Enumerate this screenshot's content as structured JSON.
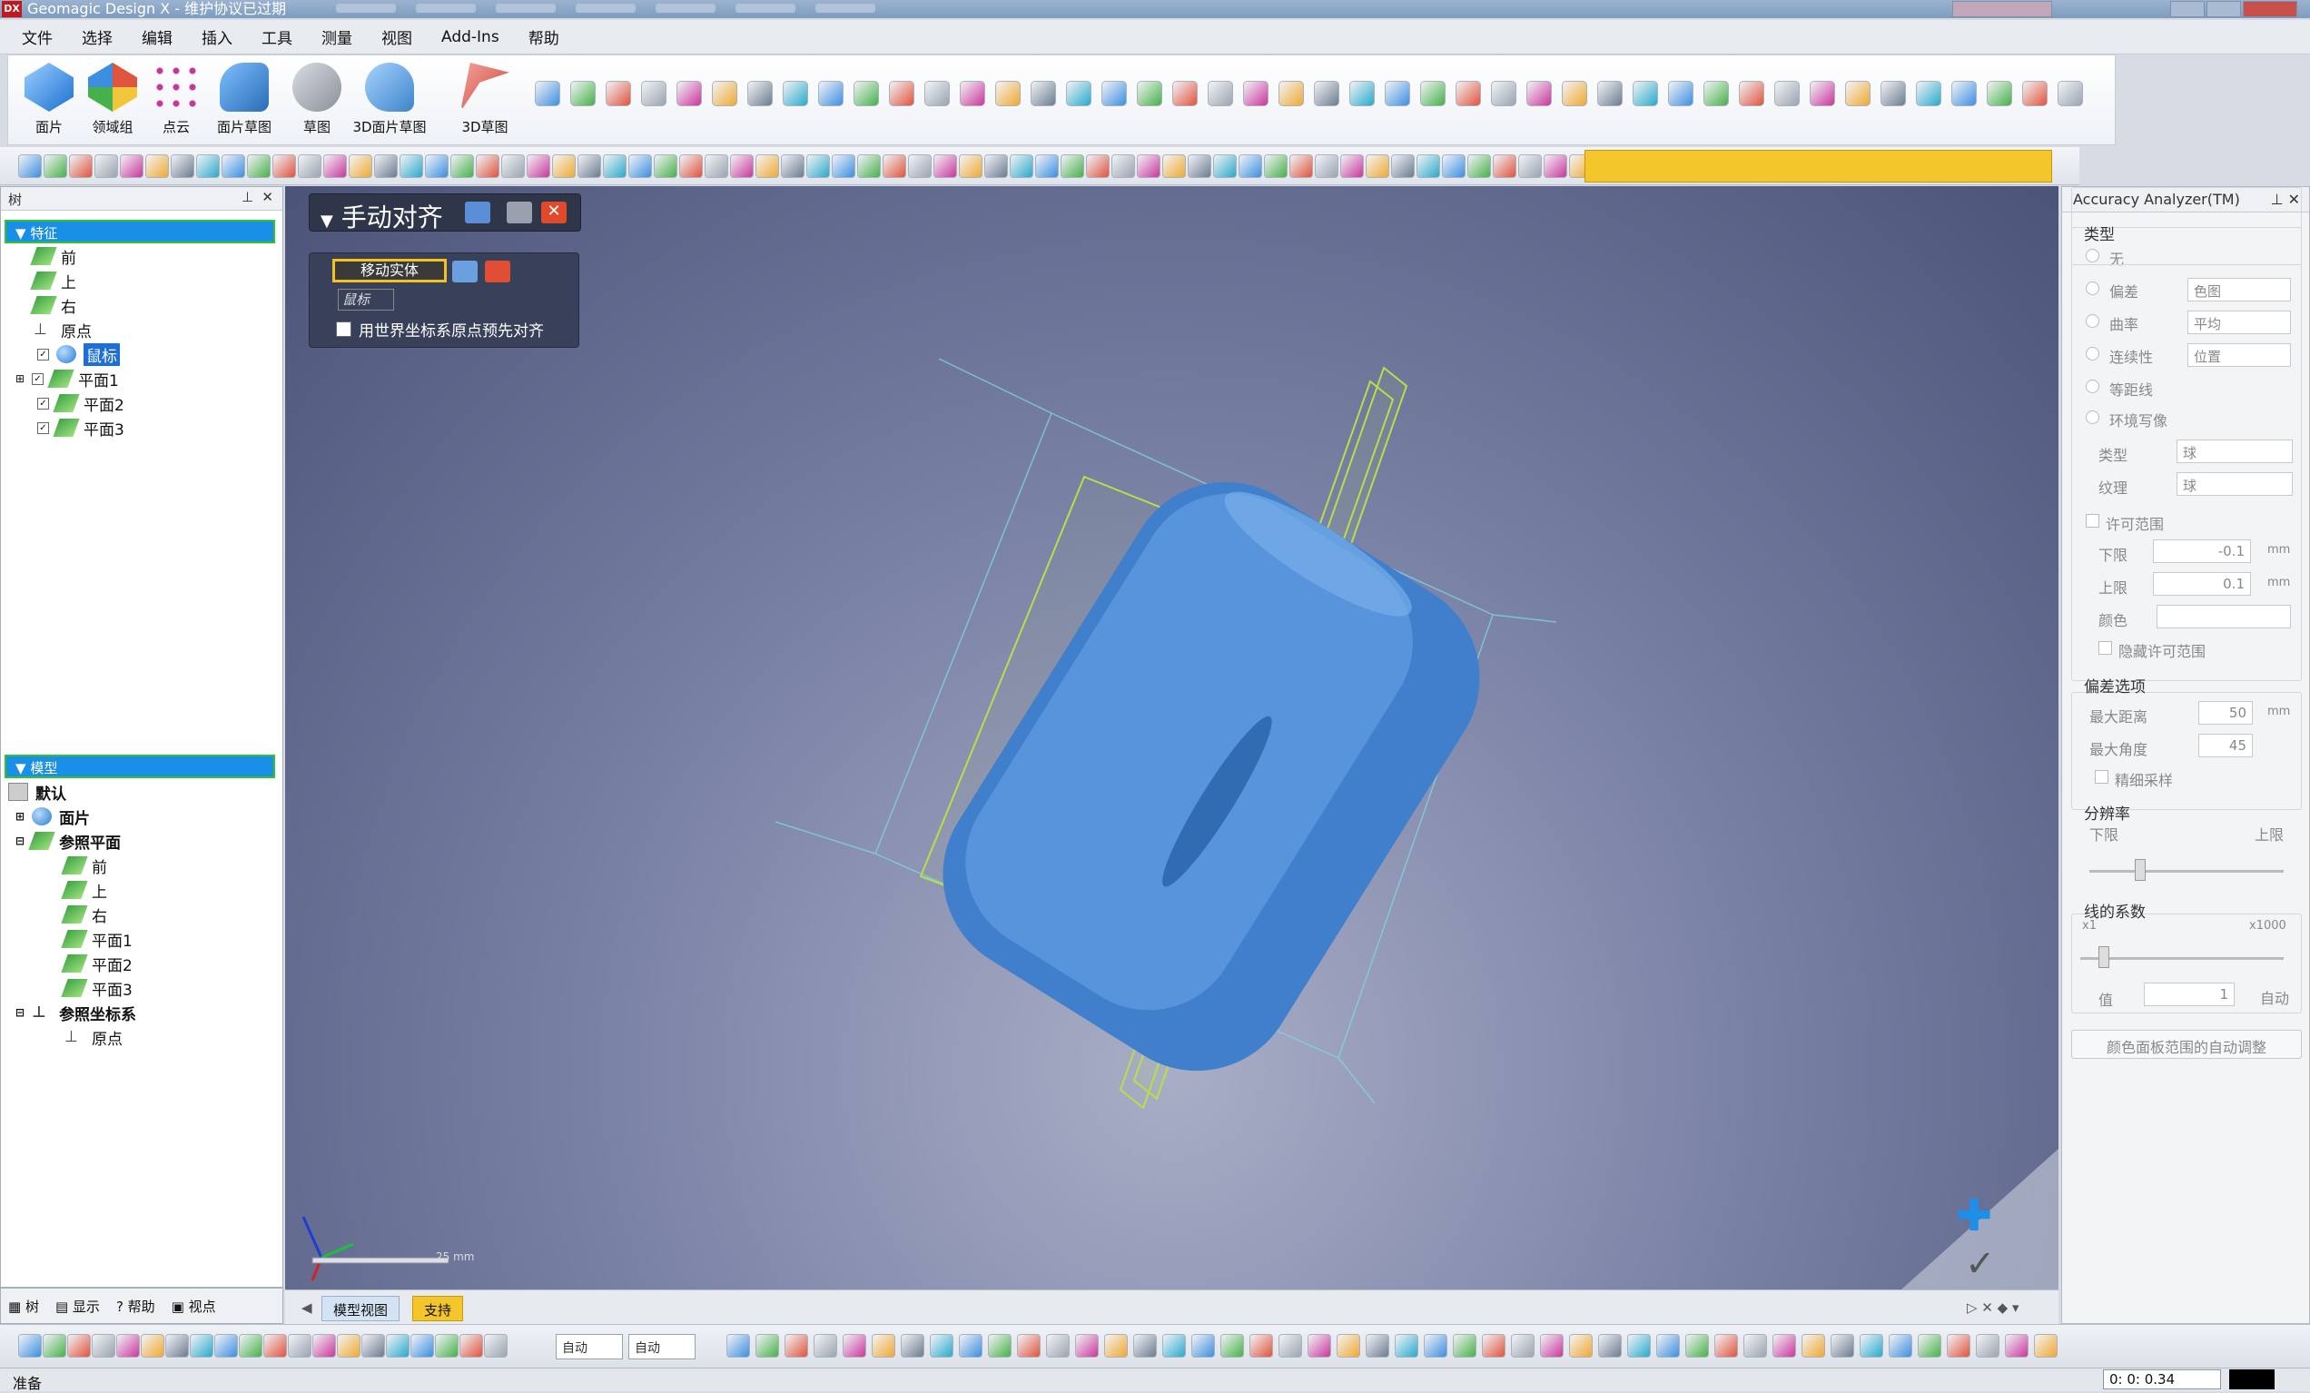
{
  "window": {
    "title": "Geomagic Design X - 维护协议已过期",
    "logo": "DX"
  },
  "menu": [
    "文件",
    "选择",
    "编辑",
    "插入",
    "工具",
    "测量",
    "视图",
    "Add-Ins",
    "帮助"
  ],
  "ribbon": {
    "big_tools": [
      {
        "label": "面片",
        "icon": "mesh-icon",
        "color": "#3b8ee0"
      },
      {
        "label": "领域组",
        "icon": "region-group-icon",
        "color": "#e0533c"
      },
      {
        "label": "点云",
        "icon": "point-cloud-icon",
        "color": "#c9369b"
      },
      {
        "label": "面片草图",
        "icon": "mesh-sketch-icon",
        "color": "#4a86c8"
      },
      {
        "label": "草图",
        "icon": "sketch-icon",
        "color": "#8a8f99"
      },
      {
        "label": "3D面片草图",
        "icon": "3d-mesh-sketch-icon",
        "color": "#3e84c9"
      },
      {
        "label": "3D草图",
        "icon": "3d-sketch-icon",
        "color": "#d0453a"
      }
    ]
  },
  "tree_panel": {
    "title": "树",
    "features_header": "特征",
    "features": [
      {
        "label": "前",
        "icon": "plane-icon"
      },
      {
        "label": "上",
        "icon": "plane-icon"
      },
      {
        "label": "右",
        "icon": "plane-icon"
      },
      {
        "label": "原点",
        "icon": "origin-icon"
      },
      {
        "label": "鼠标",
        "icon": "mesh-icon",
        "selected": true
      },
      {
        "label": "平面1",
        "icon": "plane-icon"
      },
      {
        "label": "平面2",
        "icon": "plane-icon"
      },
      {
        "label": "平面3",
        "icon": "plane-icon"
      }
    ],
    "model_header": "模型",
    "model": [
      {
        "label": "默认",
        "level": 0
      },
      {
        "label": "面片",
        "level": 1
      },
      {
        "label": "参照平面",
        "level": 1
      },
      {
        "label": "前",
        "level": 2
      },
      {
        "label": "上",
        "level": 2
      },
      {
        "label": "右",
        "level": 2
      },
      {
        "label": "平面1",
        "level": 2
      },
      {
        "label": "平面2",
        "level": 2
      },
      {
        "label": "平面3",
        "level": 2
      },
      {
        "label": "参照坐标系",
        "level": 1
      },
      {
        "label": "原点",
        "level": 2
      }
    ],
    "bottom_tabs": [
      "树",
      "显示",
      "帮助",
      "视点"
    ]
  },
  "dialog": {
    "title": "手动对齐",
    "move_entity_label": "移动实体",
    "origin_placeholder": "鼠标",
    "prealign_label": "用世界坐标系原点预先对齐",
    "prealign_checked": true
  },
  "viewport": {
    "scale_label": "25 mm",
    "tabs": [
      "模型视图",
      "支持"
    ]
  },
  "accuracy_panel": {
    "title": "Accuracy Analyzer(TM)",
    "type_label": "类型",
    "radios": [
      "无",
      "偏差",
      "曲率",
      "连续性",
      "等距线",
      "环境写像"
    ],
    "deviation_value": "色图",
    "curvature_value": "平均",
    "continuity_value": "位置",
    "type_field_label": "类型",
    "type_field_value": "球",
    "texture_label": "纹理",
    "texture_value": "球",
    "tolerance_label": "许可范围",
    "lower_label": "下限",
    "lower_value": "-0.1",
    "upper_label": "上限",
    "upper_value": "0.1",
    "unit": "mm",
    "color_label": "颜色",
    "hide_tolerance": "隐藏许可范围",
    "deviation_options": "偏差选项",
    "max_distance_label": "最大距离",
    "max_distance_value": "50",
    "max_angle_label": "最大角度",
    "max_angle_value": "45",
    "fine_sampling": "精细采样",
    "resolution_label": "分辨率",
    "res_low": "下限",
    "res_high": "上限",
    "line_factor_label": "线的系数",
    "factor_min": "x1",
    "factor_max": "x1000",
    "value_label": "值",
    "value_value": "1",
    "auto_label": "自动",
    "auto_adjust_btn": "颜色面板范围的自动调整"
  },
  "bottom_toolbar": {
    "select1": "自动",
    "select2": "自动"
  },
  "status": {
    "text": "准备",
    "coords": "0: 0: 0.34"
  }
}
